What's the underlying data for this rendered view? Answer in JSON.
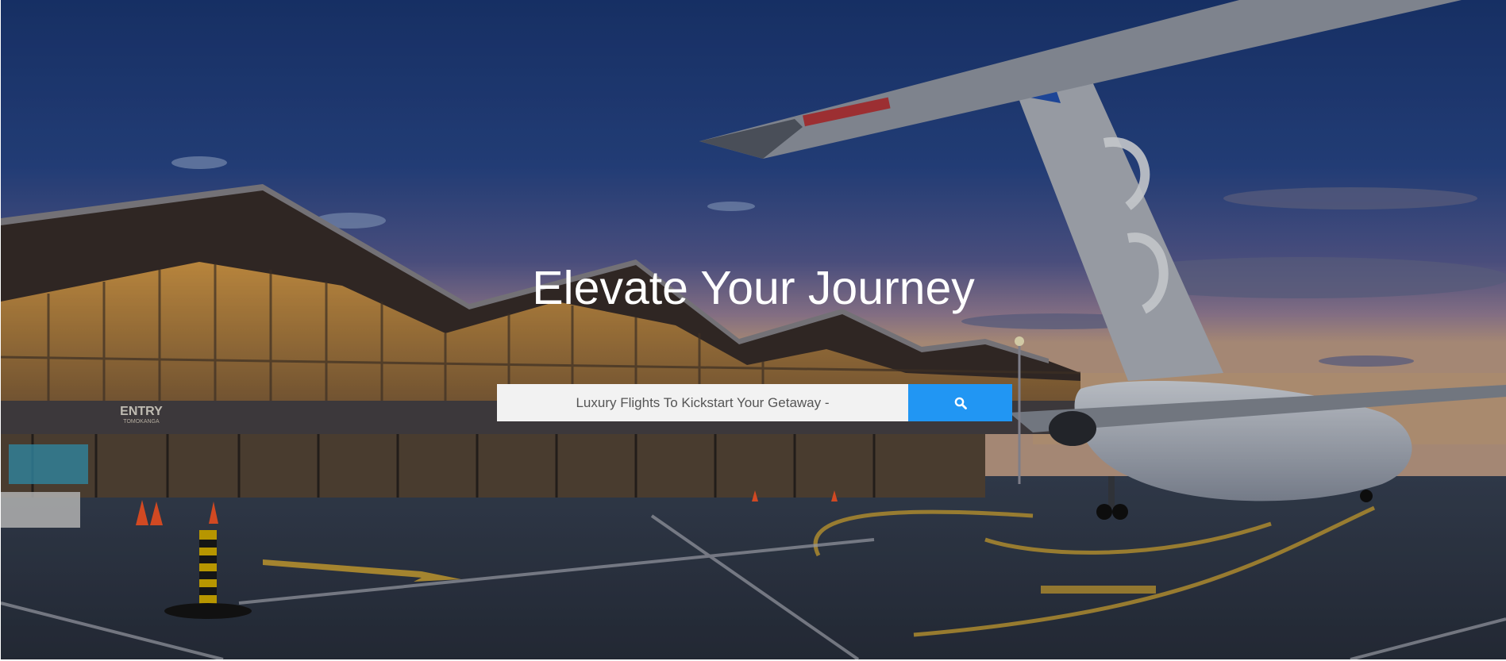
{
  "hero": {
    "title": "Elevate Your Journey",
    "background_description_icon": "airport-apron-photo",
    "entry_sign": "ENTRY",
    "entry_sign_sub": "TOMOKANGA"
  },
  "search": {
    "placeholder": "Luxury Flights To Kickstart Your Getaway -",
    "button_icon": "search-icon"
  },
  "colors": {
    "accent": "#2196f3",
    "input_bg": "#f2f2f2",
    "title": "#ffffff"
  }
}
